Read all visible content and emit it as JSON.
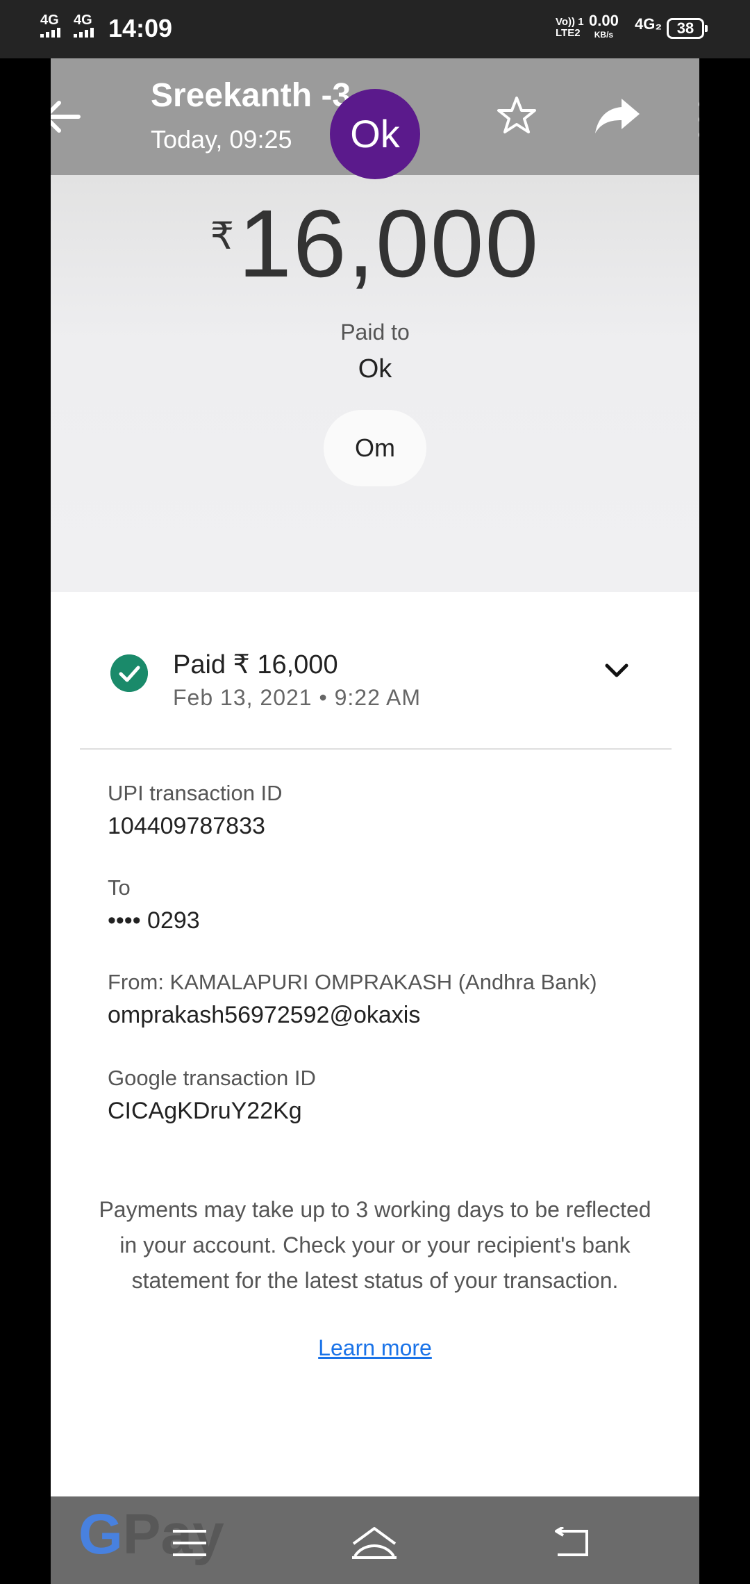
{
  "status_bar": {
    "signal1": "4G",
    "signal2": "4G",
    "time": "14:09",
    "volte": "Vo)) 1\nLTE2",
    "speed_value": "0.00",
    "speed_unit": "KB/s",
    "network2": "4G₂",
    "battery": "38"
  },
  "header": {
    "title": "Sreekanth -3",
    "subtitle": "Today, 09:25",
    "avatar_text": "Ok"
  },
  "payment": {
    "currency_symbol": "₹",
    "amount": "16,000",
    "paid_to_label": "Paid to",
    "payee": "Ok",
    "note": "Om"
  },
  "status": {
    "text": "Paid ₹ 16,000",
    "datetime": "Feb 13, 2021 • 9:22 AM"
  },
  "details": {
    "upi_label": "UPI transaction ID",
    "upi_value": "104409787833",
    "to_label": "To",
    "to_value": "•••• 0293",
    "from_label": "From: KAMALAPURI OMPRAKASH (Andhra Bank)",
    "from_value": "omprakash56972592@okaxis",
    "google_label": "Google transaction ID",
    "google_value": "CICAgKDruY22Kg"
  },
  "info": {
    "text": "Payments may take up to 3 working days to be reflected in your account. Check your or your recipient's bank statement for the latest status of your transaction.",
    "learn_more": "Learn more"
  },
  "branding": {
    "g": "G",
    "pay": "Pay"
  },
  "colors": {
    "avatar": "#5b1a8c",
    "success": "#1a8a6a",
    "link": "#1a73e8"
  }
}
